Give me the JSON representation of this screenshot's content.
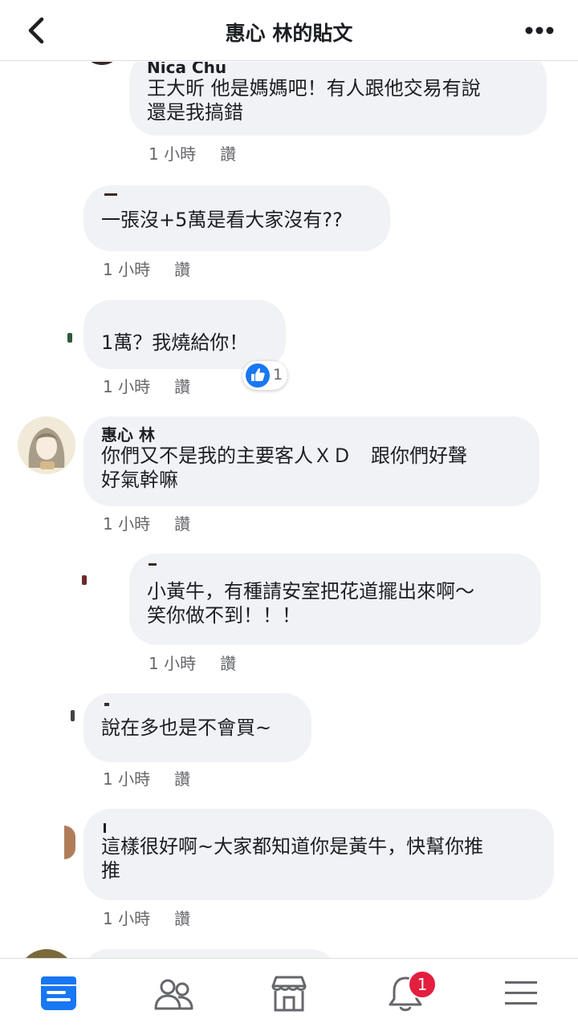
{
  "header": {
    "title": "惠心 林的貼文",
    "back_icon": "chevron-left-icon",
    "more_icon": "more-horizontal-icon"
  },
  "comments": [
    {
      "name": "Nica Chu",
      "text": "王大昕 他是媽媽吧！有人跟他交易有說\n還是我搞錯",
      "time": "1 小時",
      "action": "讚"
    },
    {
      "name": "",
      "text": "一張沒+5萬是看大家沒有??",
      "time": "1 小時",
      "action": "讚"
    },
    {
      "name": "",
      "text": "1萬？我燒給你！",
      "time": "1 小時",
      "action": "讚",
      "reaction_count": "1"
    },
    {
      "name": "惠心 林",
      "text": "你們又不是我的主要客人ＸＤ　跟你們好聲\n好氣幹嘛",
      "time": "1 小時",
      "action": "讚"
    },
    {
      "name": "",
      "text": "小黃牛，有種請安室把花道擺出來啊～\n笑你做不到！！！",
      "time": "1 小時",
      "action": "讚"
    },
    {
      "name": "",
      "text": "說在多也是不會買~",
      "time": "1 小時",
      "action": "讚"
    },
    {
      "name": "",
      "text": "這樣很好啊~大家都知道你是黃牛，快幫你推\n推",
      "time": "1 小時",
      "action": "讚"
    }
  ],
  "bottom_nav": {
    "tabs": [
      "news-feed-icon",
      "friends-icon",
      "marketplace-icon",
      "notifications-icon",
      "menu-icon"
    ],
    "notification_badge": "1"
  },
  "colors": {
    "bubble": "#f0f2f5",
    "accent": "#1877f2",
    "badge": "#e41e3f",
    "meta_text": "#65676b"
  }
}
